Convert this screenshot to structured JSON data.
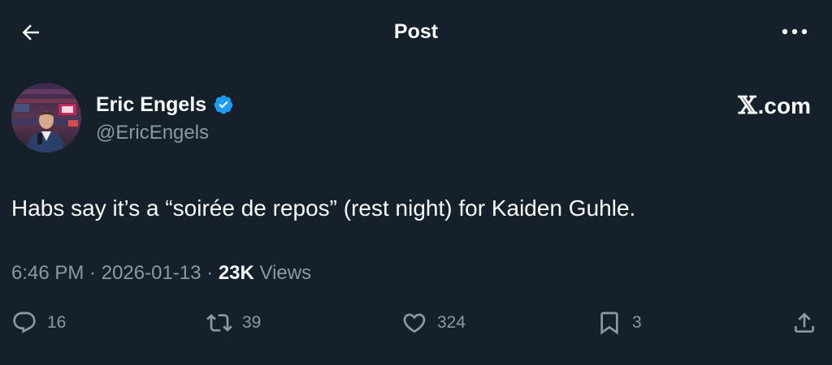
{
  "header": {
    "title": "Post",
    "back_icon": "arrow-left-icon",
    "more_icon": "more-horizontal-icon"
  },
  "author": {
    "name": "Eric Engels",
    "handle": "@EricEngels",
    "verified": true,
    "verified_color": "#1d9bf0"
  },
  "brand": {
    "x_glyph": "𝕏",
    "suffix": ".com"
  },
  "post": {
    "text": "Habs say it’s a “soirée de repos” (rest night) for Kaiden Guhle.",
    "time": "6:46 PM",
    "date": "2026-01-13",
    "separator": " · ",
    "views_count": "23K",
    "views_label": "Views"
  },
  "actions": {
    "replies": "16",
    "reposts": "39",
    "likes": "324",
    "bookmarks": "3"
  },
  "colors": {
    "background": "#15202b",
    "text_primary": "#f7f9f9",
    "text_secondary": "#8b98a5"
  }
}
